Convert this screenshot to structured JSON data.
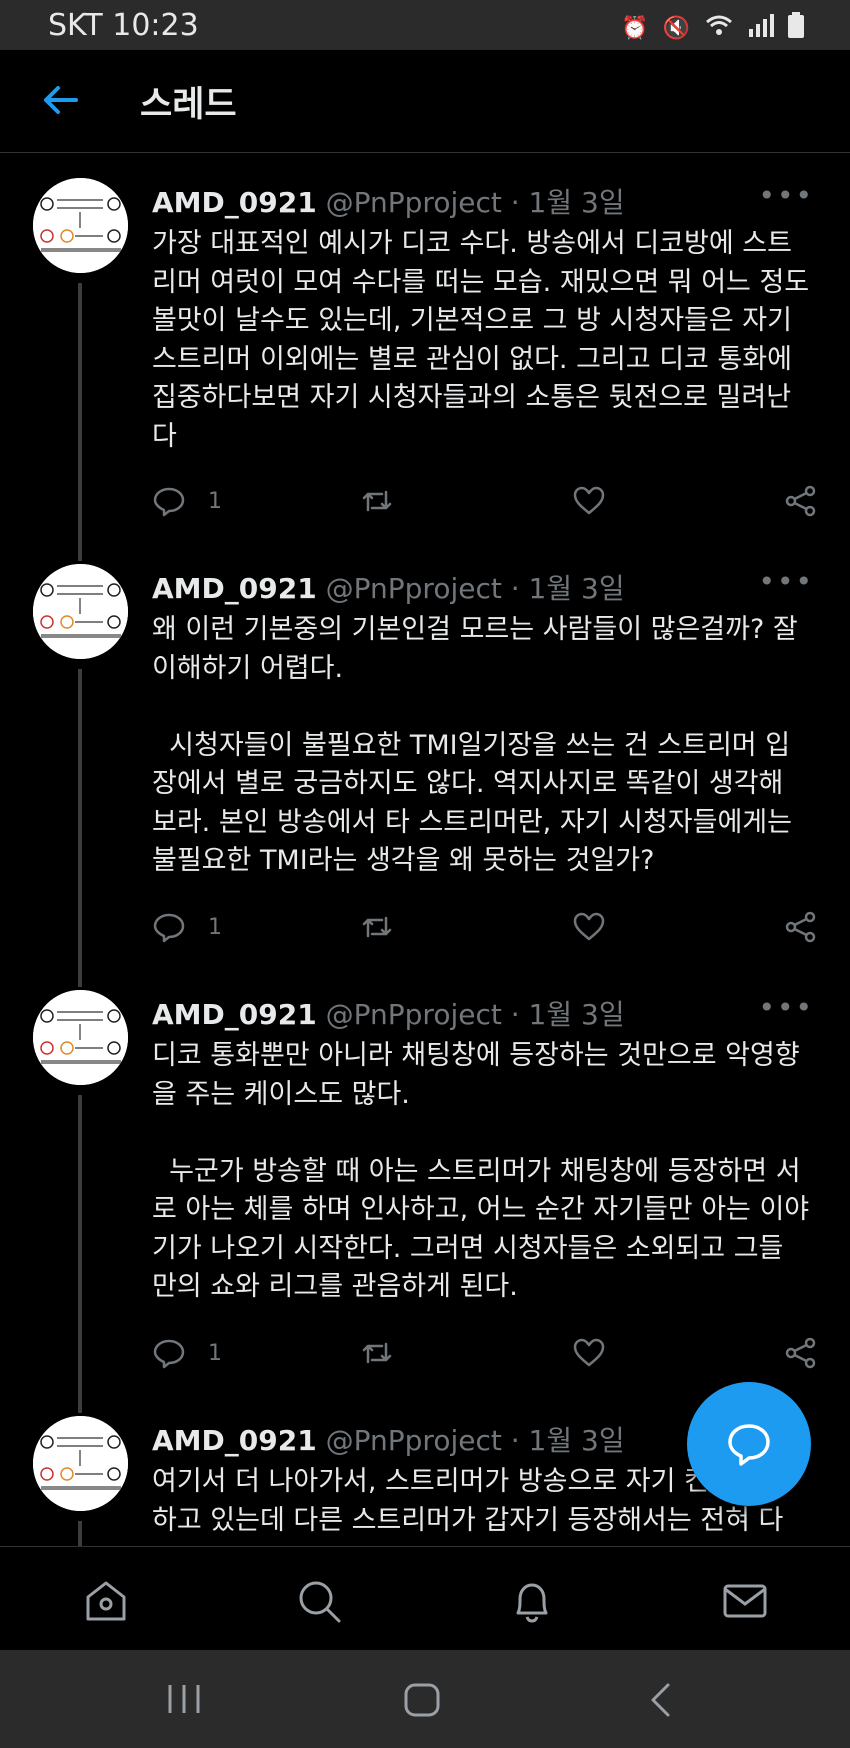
{
  "status_bar": {
    "carrier_time": "SKT 10:23"
  },
  "header": {
    "title": "스레드"
  },
  "tweets": [
    {
      "username": "AMD_0921",
      "handle": "@PnPproject",
      "date": "1월 3일",
      "body": "가장 대표적인 예시가 디코 수다. 방송에서 디코방에 스트\n리머 여럿이 모여 수다를 떠는 모습. 재밌으면 뭐 어느 정도\n볼맛이 날수도 있는데, 기본적으로 그 방 시청자들은 자기\n스트리머 이외에는 별로 관심이 없다. 그리고 디코 통화에\n집중하다보면 자기 시청자들과의 소통은 뒷전으로 밀려난\n다",
      "reply_count": "1"
    },
    {
      "username": "AMD_0921",
      "handle": "@PnPproject",
      "date": "1월 3일",
      "body": "왜 이런 기본중의 기본인걸 모르는 사람들이 많은걸까? 잘\n이해하기 어렵다.\n\n  시청자들이 불필요한 TMI일기장을 쓰는 건 스트리머 입\n장에서 별로 궁금하지도 않다. 역지사지로 똑같이 생각해\n보라. 본인 방송에서 타 스트리머란, 자기 시청자들에게는\n불필요한 TMI라는 생각을 왜 못하는 것일가?",
      "reply_count": "1"
    },
    {
      "username": "AMD_0921",
      "handle": "@PnPproject",
      "date": "1월 3일",
      "body": "디코 통화뿐만 아니라 채팅창에 등장하는 것만으로 악영향\n을 주는 케이스도 많다.\n\n  누군가 방송할 때 아는 스트리머가 채팅창에 등장하면 서\n로 아는 체를 하며 인사하고, 어느 순간 자기들만 아는 이야\n기가 나오기 시작한다. 그러면 시청자들은 소외되고 그들\n만의 쇼와 리그를 관음하게 된다.",
      "reply_count": "1"
    },
    {
      "username": "AMD_0921",
      "handle": "@PnPproject",
      "date": "1월 3일",
      "body": "여기서 더 나아가서, 스트리머가 방송으로 자기 컨텐츠를\n하고 있는데 다른 스트리머가 갑자기 등장해서는 전혀 다",
      "reply_count": ""
    }
  ],
  "colors": {
    "accent": "#1d9bf0",
    "background": "#000000",
    "muted": "#71767b"
  }
}
